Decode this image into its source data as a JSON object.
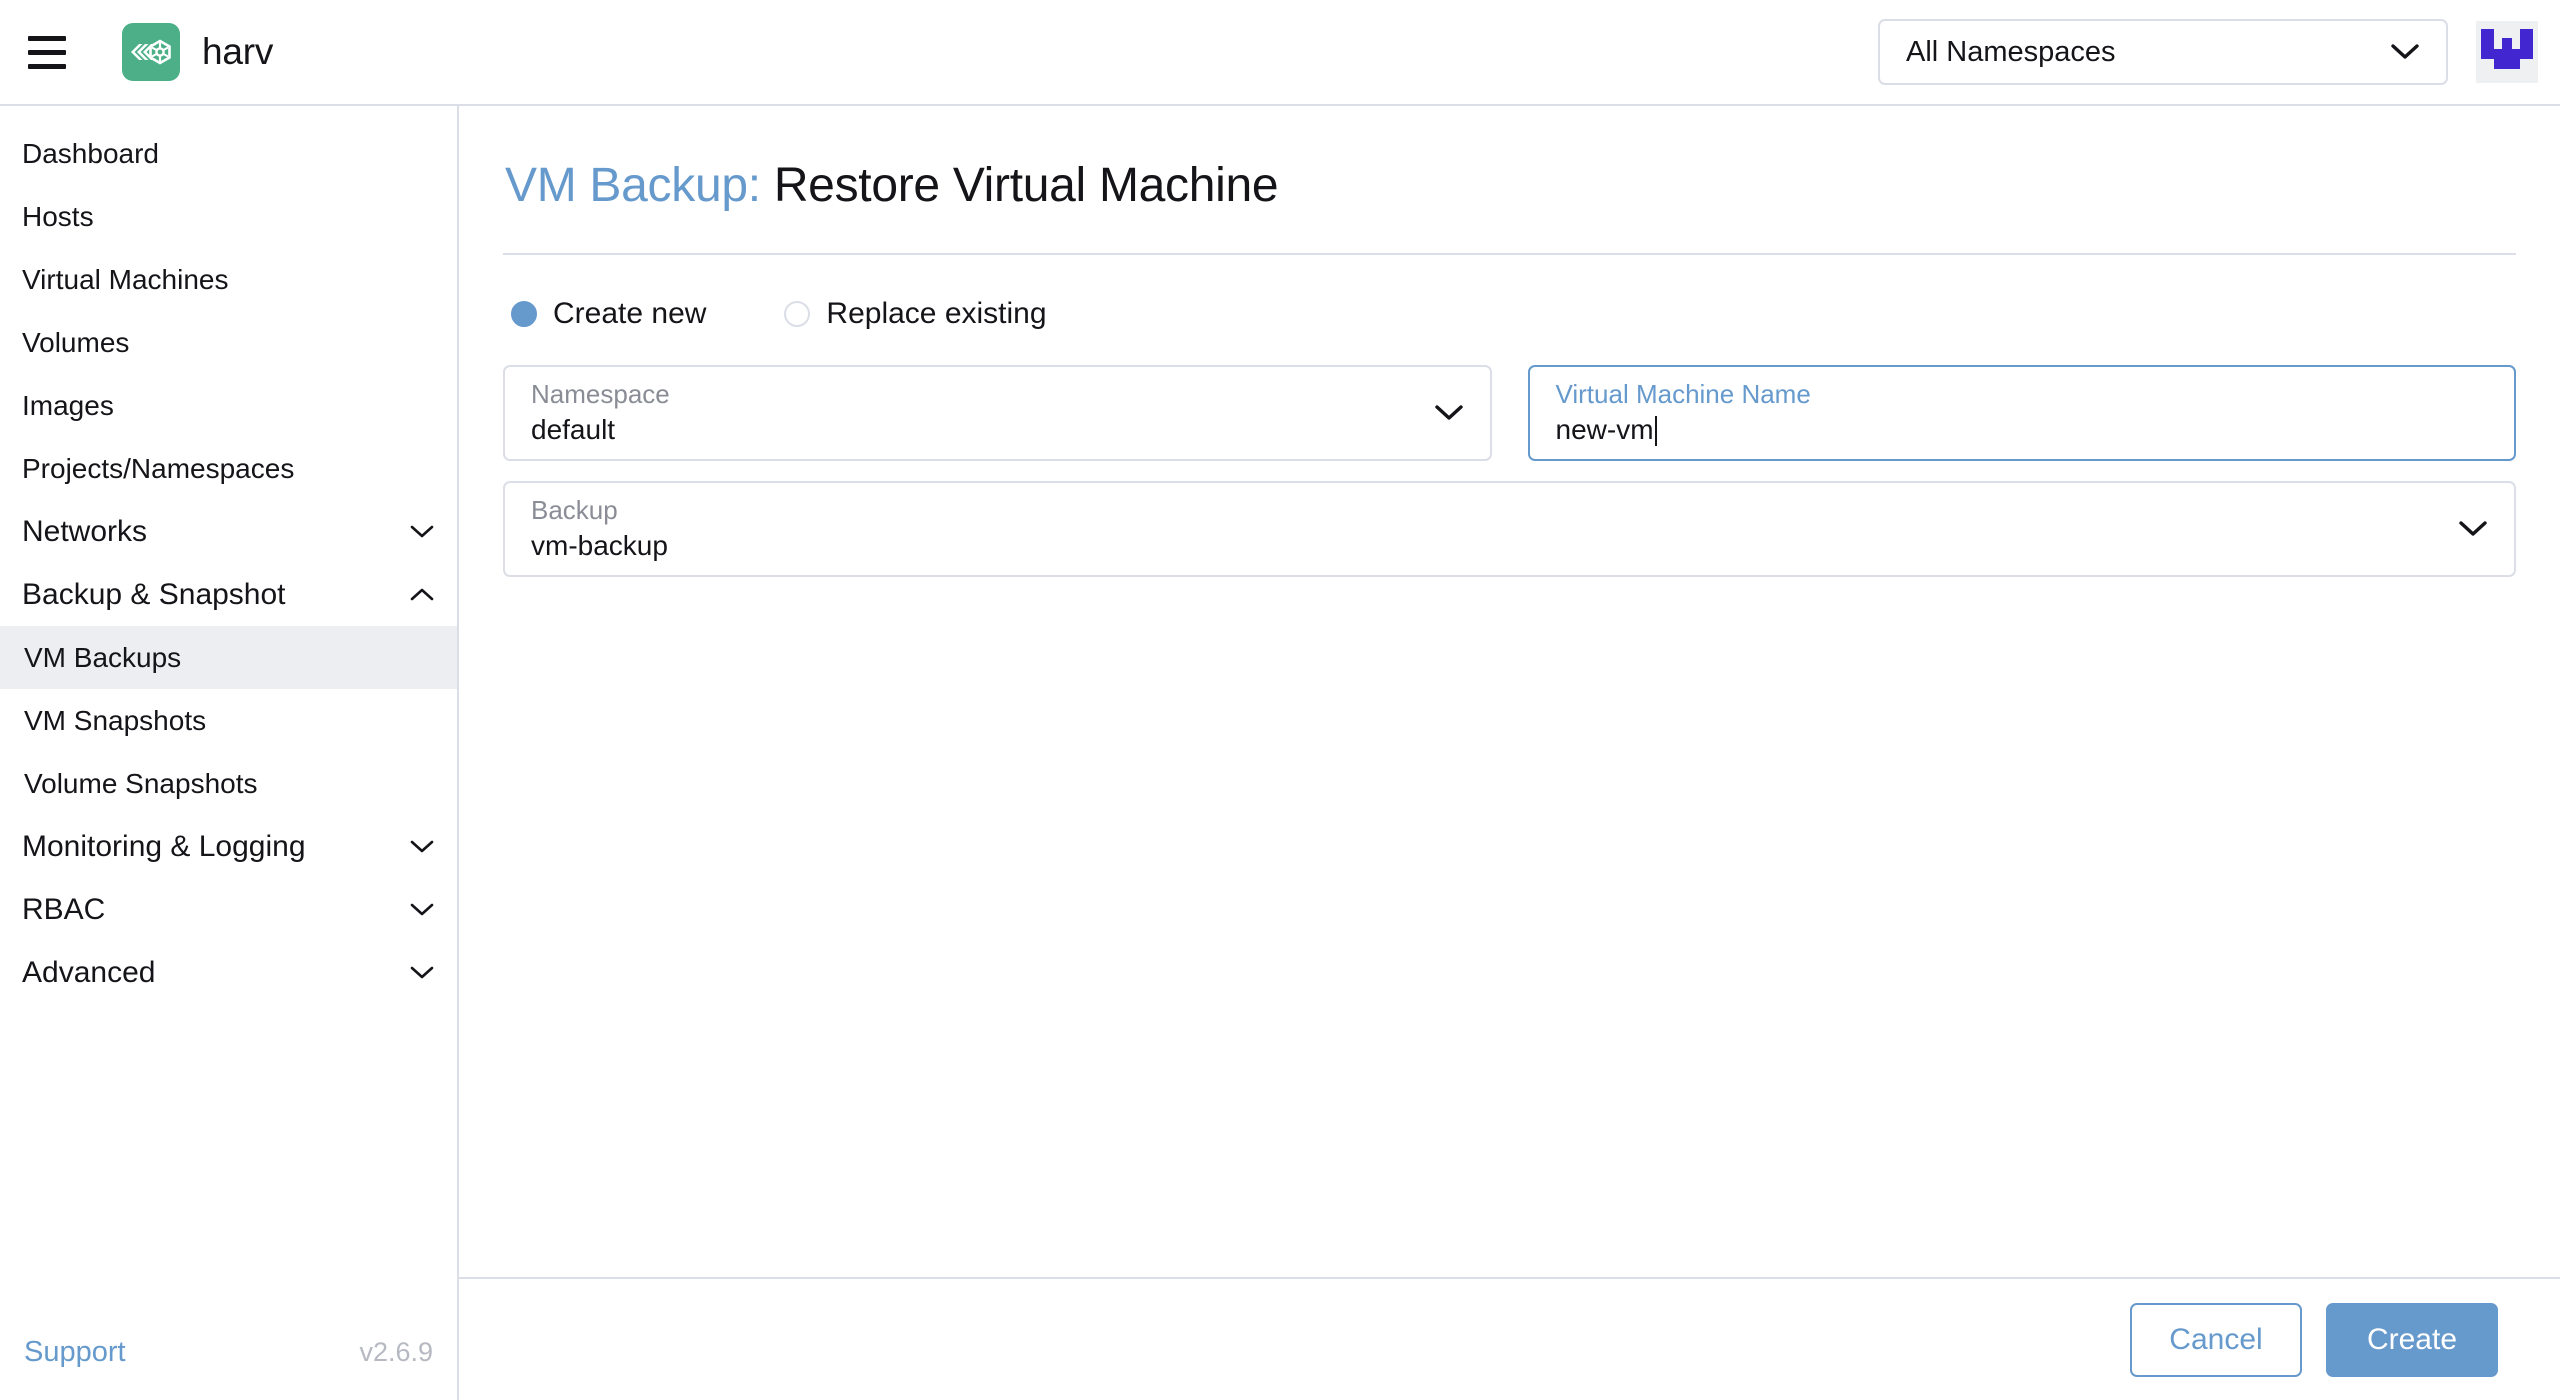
{
  "header": {
    "menu_icon": "hamburger-icon",
    "brand_logo_icon": "harvester-logo-icon",
    "brand_name": "harv",
    "namespace_selector": {
      "value": "All Namespaces",
      "chevron_icon": "chevron-down-icon"
    },
    "avatar_icon": "user-avatar-icon"
  },
  "sidebar": {
    "items": [
      {
        "label": "Dashboard",
        "type": "link",
        "active": false,
        "chevron": ""
      },
      {
        "label": "Hosts",
        "type": "link",
        "active": false,
        "chevron": ""
      },
      {
        "label": "Virtual Machines",
        "type": "link",
        "active": false,
        "chevron": ""
      },
      {
        "label": "Volumes",
        "type": "link",
        "active": false,
        "chevron": ""
      },
      {
        "label": "Images",
        "type": "link",
        "active": false,
        "chevron": ""
      },
      {
        "label": "Projects/Namespaces",
        "type": "link",
        "active": false,
        "chevron": ""
      },
      {
        "label": "Networks",
        "type": "group",
        "active": false,
        "chevron": "chevron-down-icon"
      },
      {
        "label": "Backup & Snapshot",
        "type": "group",
        "active": false,
        "chevron": "chevron-up-icon"
      },
      {
        "label": "VM Backups",
        "type": "child",
        "active": true,
        "chevron": ""
      },
      {
        "label": "VM Snapshots",
        "type": "child",
        "active": false,
        "chevron": ""
      },
      {
        "label": "Volume Snapshots",
        "type": "child",
        "active": false,
        "chevron": ""
      },
      {
        "label": "Monitoring & Logging",
        "type": "group",
        "active": false,
        "chevron": "chevron-down-icon"
      },
      {
        "label": "RBAC",
        "type": "group",
        "active": false,
        "chevron": "chevron-down-icon"
      },
      {
        "label": "Advanced",
        "type": "group",
        "active": false,
        "chevron": "chevron-down-icon"
      }
    ],
    "footer": {
      "support_label": "Support",
      "version_label": "v2.6.9"
    }
  },
  "main": {
    "title_prefix": "VM Backup:",
    "title_rest": " Restore Virtual Machine",
    "restore_mode": {
      "options": [
        {
          "label": "Create new",
          "selected": true
        },
        {
          "label": "Replace existing",
          "selected": false
        }
      ]
    },
    "fields": {
      "namespace": {
        "label": "Namespace",
        "value": "default",
        "chevron_icon": "chevron-down-icon"
      },
      "vm_name": {
        "label": "Virtual Machine Name",
        "value": "new-vm",
        "focused": true
      },
      "backup": {
        "label": "Backup",
        "value": "vm-backup",
        "chevron_icon": "chevron-down-icon"
      }
    },
    "footer": {
      "cancel_label": "Cancel",
      "create_label": "Create"
    }
  },
  "colors": {
    "accent_blue": "#6699cc",
    "brand_green": "#4caf88",
    "avatar_purple": "#4226cf",
    "border": "#dcdee7",
    "active_nav_bg": "#eceef2",
    "muted_text": "#8a8d96"
  }
}
